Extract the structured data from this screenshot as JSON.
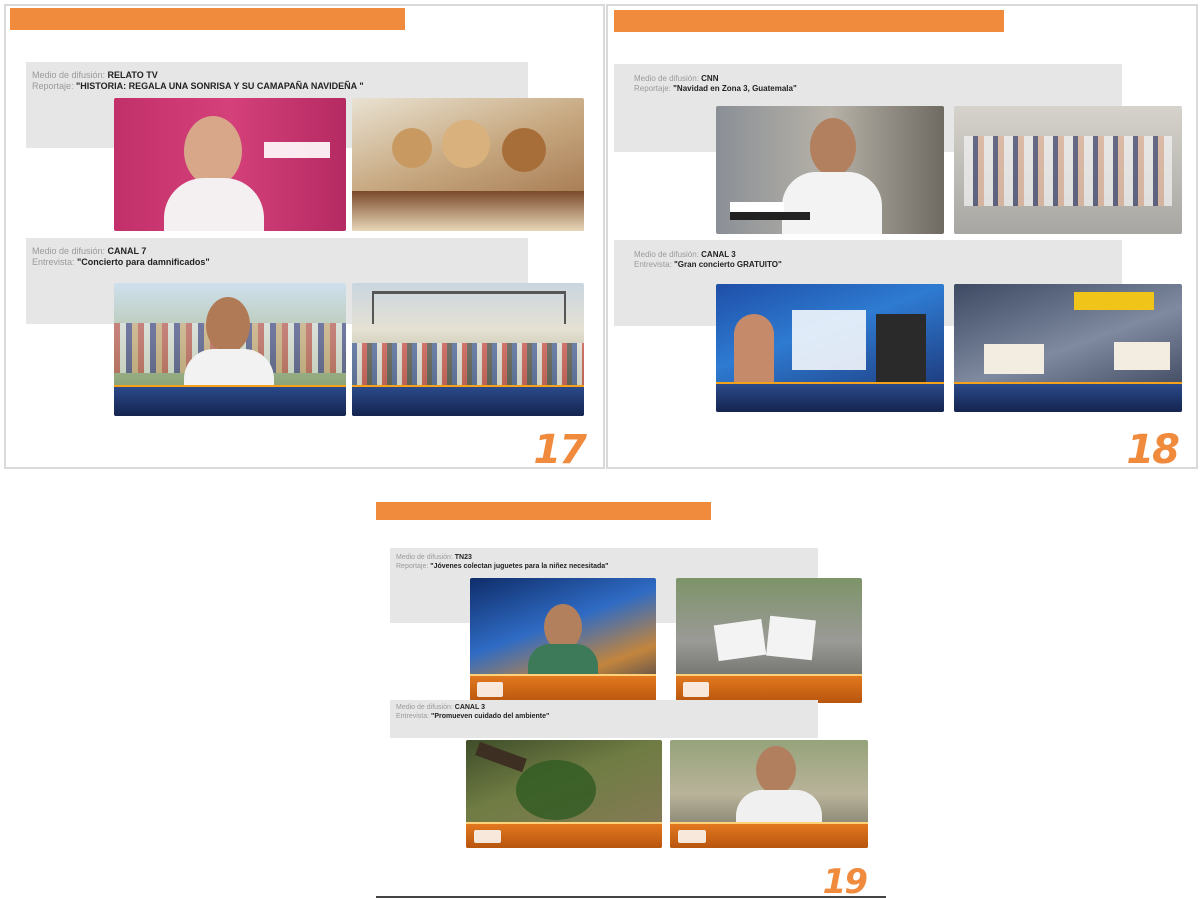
{
  "pages": [
    {
      "number": "17",
      "items": [
        {
          "label": "Medio de difusión: ",
          "medium": "RELATO TV",
          "kind_label": "Reportaje: ",
          "title": "\"HISTORIA: REGALA UNA SONRISA Y SU CAMAPAÑA NAVIDEÑA \""
        },
        {
          "label": "Medio de difusión: ",
          "medium": "CANAL 7",
          "kind_label": "Entrevista: ",
          "title": "\"Concierto para damnificados\""
        }
      ]
    },
    {
      "number": "18",
      "items": [
        {
          "label": "Medio de difusión: ",
          "medium": "CNN",
          "kind_label": "Reportaje: ",
          "title": "\"Navidad en Zona 3, Guatemala\""
        },
        {
          "label": "Medio de difusión: ",
          "medium": "CANAL 3",
          "kind_label": "Entrevista: ",
          "title": "\"Gran concierto GRATUITO\""
        }
      ]
    },
    {
      "number": "19",
      "items": [
        {
          "label": "Medio de difusión: ",
          "medium": "TN23",
          "kind_label": "Reportaje: ",
          "title": "\"Jóvenes colectan juguetes para la niñez necesitada\""
        },
        {
          "label": "Medio de difusión: ",
          "medium": "CANAL 3",
          "kind_label": "Entrevista: ",
          "title": "\"Promueven cuidado del ambiente\""
        }
      ]
    }
  ],
  "colors": {
    "accent": "#f08a3c",
    "band": "#e6e6e6"
  },
  "photo_descriptions": [
    "woman interview pink background",
    "teddy bears toys",
    "man interview at concert crowd",
    "concert stage crowd",
    "man with microphone interview",
    "group photo",
    "tv studio set",
    "tv studio set with banner",
    "news anchor studio",
    "people holding banners",
    "planting tree",
    "man interview outdoors"
  ]
}
